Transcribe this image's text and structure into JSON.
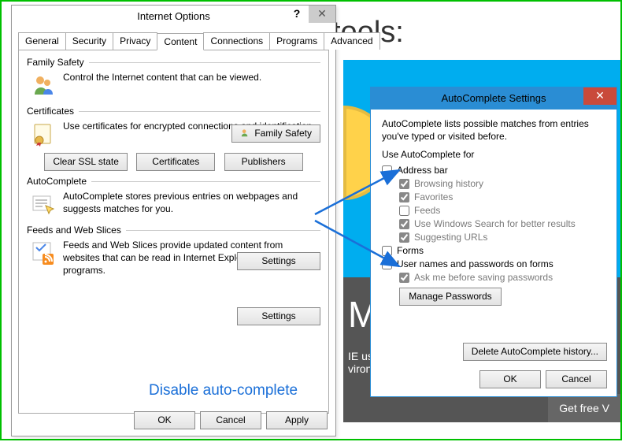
{
  "background": {
    "tools_word": "tools:",
    "big_letter_prefix": "M",
    "ie_line": "IE usi",
    "viron_line": "viron",
    "get_free": "Get free V"
  },
  "io": {
    "title": "Internet Options",
    "help_glyph": "?",
    "close_glyph": "✕",
    "tabs": [
      "General",
      "Security",
      "Privacy",
      "Content",
      "Connections",
      "Programs",
      "Advanced"
    ],
    "active_tab_index": 3,
    "family": {
      "label": "Family Safety",
      "desc": "Control the Internet content that can be viewed.",
      "btn": "Family Safety"
    },
    "certs": {
      "label": "Certificates",
      "desc": "Use certificates for encrypted connections and identification.",
      "btn_clear": "Clear SSL state",
      "btn_certs": "Certificates",
      "btn_pub": "Publishers"
    },
    "auto": {
      "label": "AutoComplete",
      "desc": "AutoComplete stores previous entries on webpages and suggests matches for you.",
      "btn": "Settings"
    },
    "feeds": {
      "label": "Feeds and Web Slices",
      "desc": "Feeds and Web Slices provide updated content from websites that can be read in Internet Explorer and other programs.",
      "btn": "Settings"
    },
    "annotation": "Disable auto-complete",
    "ok": "OK",
    "cancel": "Cancel",
    "apply": "Apply"
  },
  "ac": {
    "title": "AutoComplete Settings",
    "close_glyph": "✕",
    "intro": "AutoComplete lists possible matches from entries you've typed or visited before.",
    "use_for": "Use AutoComplete for",
    "address_bar": {
      "label": "Address bar",
      "checked": false
    },
    "browsing_history": {
      "label": "Browsing history",
      "checked": true
    },
    "favorites": {
      "label": "Favorites",
      "checked": true
    },
    "feeds": {
      "label": "Feeds",
      "checked": false
    },
    "win_search": {
      "label": "Use Windows Search for better results",
      "checked": true
    },
    "suggesting": {
      "label": "Suggesting URLs",
      "checked": true
    },
    "forms": {
      "label": "Forms",
      "checked": false
    },
    "userpw": {
      "label": "User names and passwords on forms",
      "checked": false
    },
    "askme": {
      "label": "Ask me before saving passwords",
      "checked": true
    },
    "manage": "Manage Passwords",
    "delete": "Delete AutoComplete history...",
    "ok": "OK",
    "cancel": "Cancel"
  }
}
